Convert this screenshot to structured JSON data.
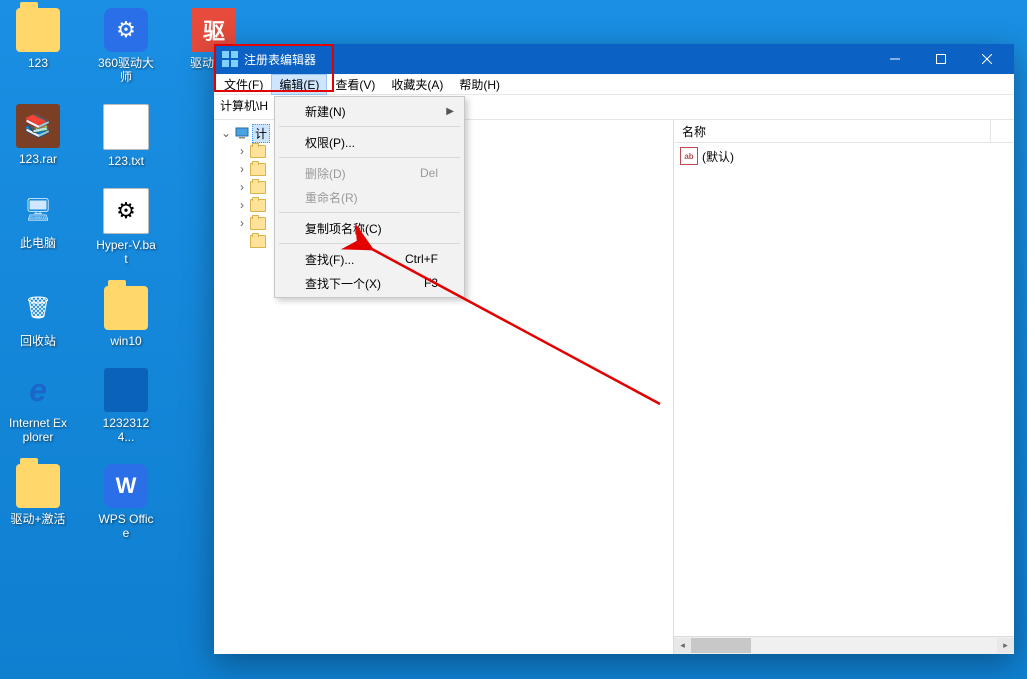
{
  "desktop": {
    "row1": [
      {
        "label": "123",
        "type": "folder"
      },
      {
        "label": "360驱动大师",
        "type": "blue-gear",
        "glyph": "⚙"
      },
      {
        "label": "驱动精灵",
        "type": "red-sq",
        "glyph": "驱"
      }
    ],
    "row2": [
      {
        "label": "123.rar",
        "type": "archive",
        "glyph": "📚"
      },
      {
        "label": "123.txt",
        "type": "textfile",
        "glyph": ""
      }
    ],
    "row3": [
      {
        "label": "此电脑",
        "type": "pc",
        "glyph": "🖥"
      },
      {
        "label": "Hyper-V.bat",
        "type": "bat",
        "glyph": "⚙"
      }
    ],
    "row4": [
      {
        "label": "回收站",
        "type": "bin",
        "glyph": "🗑"
      },
      {
        "label": "win10",
        "type": "folder"
      }
    ],
    "row5": [
      {
        "label": "Internet Explorer",
        "type": "ie",
        "glyph": "e"
      },
      {
        "label": "12323124...",
        "type": "img",
        "glyph": ""
      }
    ],
    "row6": [
      {
        "label": "驱动+激活",
        "type": "folder"
      },
      {
        "label": "WPS Office",
        "type": "wps",
        "glyph": "W"
      }
    ]
  },
  "window": {
    "title": "注册表编辑器",
    "menus": {
      "file": "文件(F)",
      "edit": "编辑(E)",
      "view": "查看(V)",
      "fav": "收藏夹(A)",
      "help": "帮助(H)"
    },
    "addressbar": "计算机\\H",
    "tree": {
      "root_label": "计",
      "children_visible": 6
    },
    "list": {
      "header_name": "名称",
      "default_label": "(默认)"
    }
  },
  "menu": {
    "new": {
      "label": "新建(N)",
      "hasSub": true
    },
    "perm": {
      "label": "权限(P)..."
    },
    "delete": {
      "label": "删除(D)",
      "shortcut": "Del",
      "disabled": true
    },
    "rename": {
      "label": "重命名(R)",
      "disabled": true
    },
    "copyname": {
      "label": "复制项名称(C)"
    },
    "find": {
      "label": "查找(F)...",
      "shortcut": "Ctrl+F"
    },
    "findnext": {
      "label": "查找下一个(X)",
      "shortcut": "F3"
    }
  }
}
